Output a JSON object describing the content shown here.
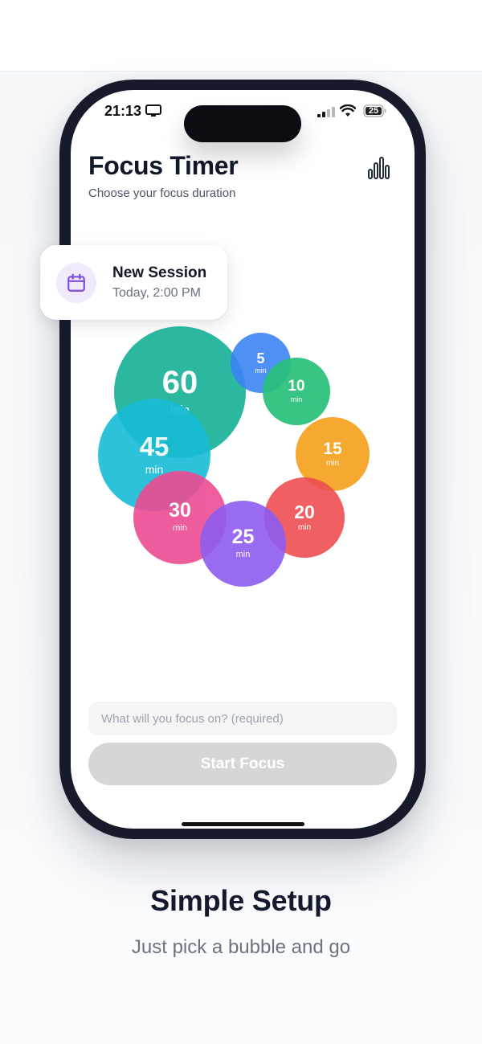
{
  "status_bar": {
    "time": "21:13",
    "battery": "25",
    "icons": [
      "monitor-icon",
      "signal-icon",
      "wifi-icon",
      "battery-icon"
    ]
  },
  "header": {
    "title": "Focus Timer",
    "subtitle": "Choose your focus duration",
    "stats_icon": "bar-chart-icon"
  },
  "session_card": {
    "icon": "calendar-icon",
    "title": "New Session",
    "time": "Today, 2:00 PM"
  },
  "bubbles": [
    {
      "value": "60",
      "unit": "min",
      "color": "#1fb39a"
    },
    {
      "value": "45",
      "unit": "min",
      "color": "#18bcd6"
    },
    {
      "value": "30",
      "unit": "min",
      "color": "#ec4c93"
    },
    {
      "value": "25",
      "unit": "min",
      "color": "#8f5cf0"
    },
    {
      "value": "20",
      "unit": "min",
      "color": "#ef4f52"
    },
    {
      "value": "15",
      "unit": "min",
      "color": "#f5a21f"
    },
    {
      "value": "10",
      "unit": "min",
      "color": "#27c07a"
    },
    {
      "value": "5",
      "unit": "min",
      "color": "#3d84f5"
    }
  ],
  "focus_input": {
    "value": "",
    "placeholder": "What will you focus on? (required)"
  },
  "start_button": {
    "label": "Start Focus"
  },
  "caption": {
    "title": "Simple Setup",
    "subtitle": "Just pick a bubble and go"
  },
  "colors": {
    "phone_frame": "#161a2a",
    "accent_purple": "#7c4dde",
    "button_disabled": "#d6d6d6"
  }
}
